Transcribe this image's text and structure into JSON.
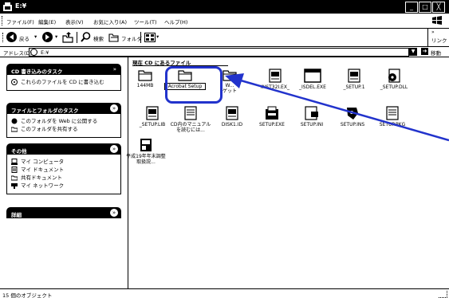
{
  "window": {
    "title": "E:¥"
  },
  "window_buttons": [
    "_",
    "□",
    "╳"
  ],
  "menu": [
    "ファイル(F)",
    "編集(E)",
    "表示(V)",
    "お気に入り(A)",
    "ツール(T)",
    "ヘルプ(H)"
  ],
  "toolbar": {
    "back": "戻る",
    "search": "検索",
    "folders": "フォルダ",
    "links": "リンク",
    "more": "»"
  },
  "address": {
    "label": "アドレス(D)",
    "value": "E:¥",
    "go": "移動"
  },
  "panels": {
    "cd": {
      "title": "CD 書き込みのタスク",
      "chevron": "»",
      "tasks": [
        "これらのファイルを CD に書き込む"
      ]
    },
    "file": {
      "title": "ファイルとフォルダのタスク",
      "chevron": "»",
      "tasks": [
        "このフォルダを Web に公開する",
        "このフォルダを共有する"
      ]
    },
    "other": {
      "title": "その他",
      "chevron": "»",
      "tasks": [
        "マイ コンピュータ",
        "マイ ドキュメント",
        "共有ドキュメント",
        "マイ ネットワーク"
      ]
    },
    "details": {
      "title": "詳細",
      "chevron": "»"
    }
  },
  "content": {
    "group_title": "現在 CD にあるファイル",
    "files": [
      {
        "name": "144MB",
        "icon": "folder"
      },
      {
        "name": "Acrobat Setup",
        "icon": "folder"
      },
      {
        "name": "W...",
        "icon": "folder"
      },
      {
        "name": "INST32I.EX_",
        "icon": "file-doc"
      },
      {
        "name": "_ISDEL.EXE",
        "icon": "window-app"
      },
      {
        "name": "_SETUP.1",
        "icon": "file-doc"
      },
      {
        "name": "_SETUP.DLL",
        "icon": "dll-file"
      },
      {
        "name": "_SETUP.LIB",
        "icon": "file-doc"
      },
      {
        "name": "CD内のマニュアルを読むには...",
        "icon": "file-doc"
      },
      {
        "name": "DISK1.ID",
        "icon": "file-doc"
      },
      {
        "name": "SETUP.EXE",
        "icon": "setup-exe"
      },
      {
        "name": "SETUP.INI",
        "icon": "ini-file"
      },
      {
        "name": "SETUP.INS",
        "icon": "ins-file"
      },
      {
        "name": "SETUP.PKG",
        "icon": "file-doc"
      },
      {
        "name": "平成19年年末調整取扱説...",
        "icon": "doc-file"
      }
    ],
    "overlap_label": "ゲット"
  },
  "annotation": {
    "highlight_color": "#2233cc",
    "arrow_color": "#2233cc"
  },
  "status": {
    "text": "15 個のオブジェクト"
  }
}
